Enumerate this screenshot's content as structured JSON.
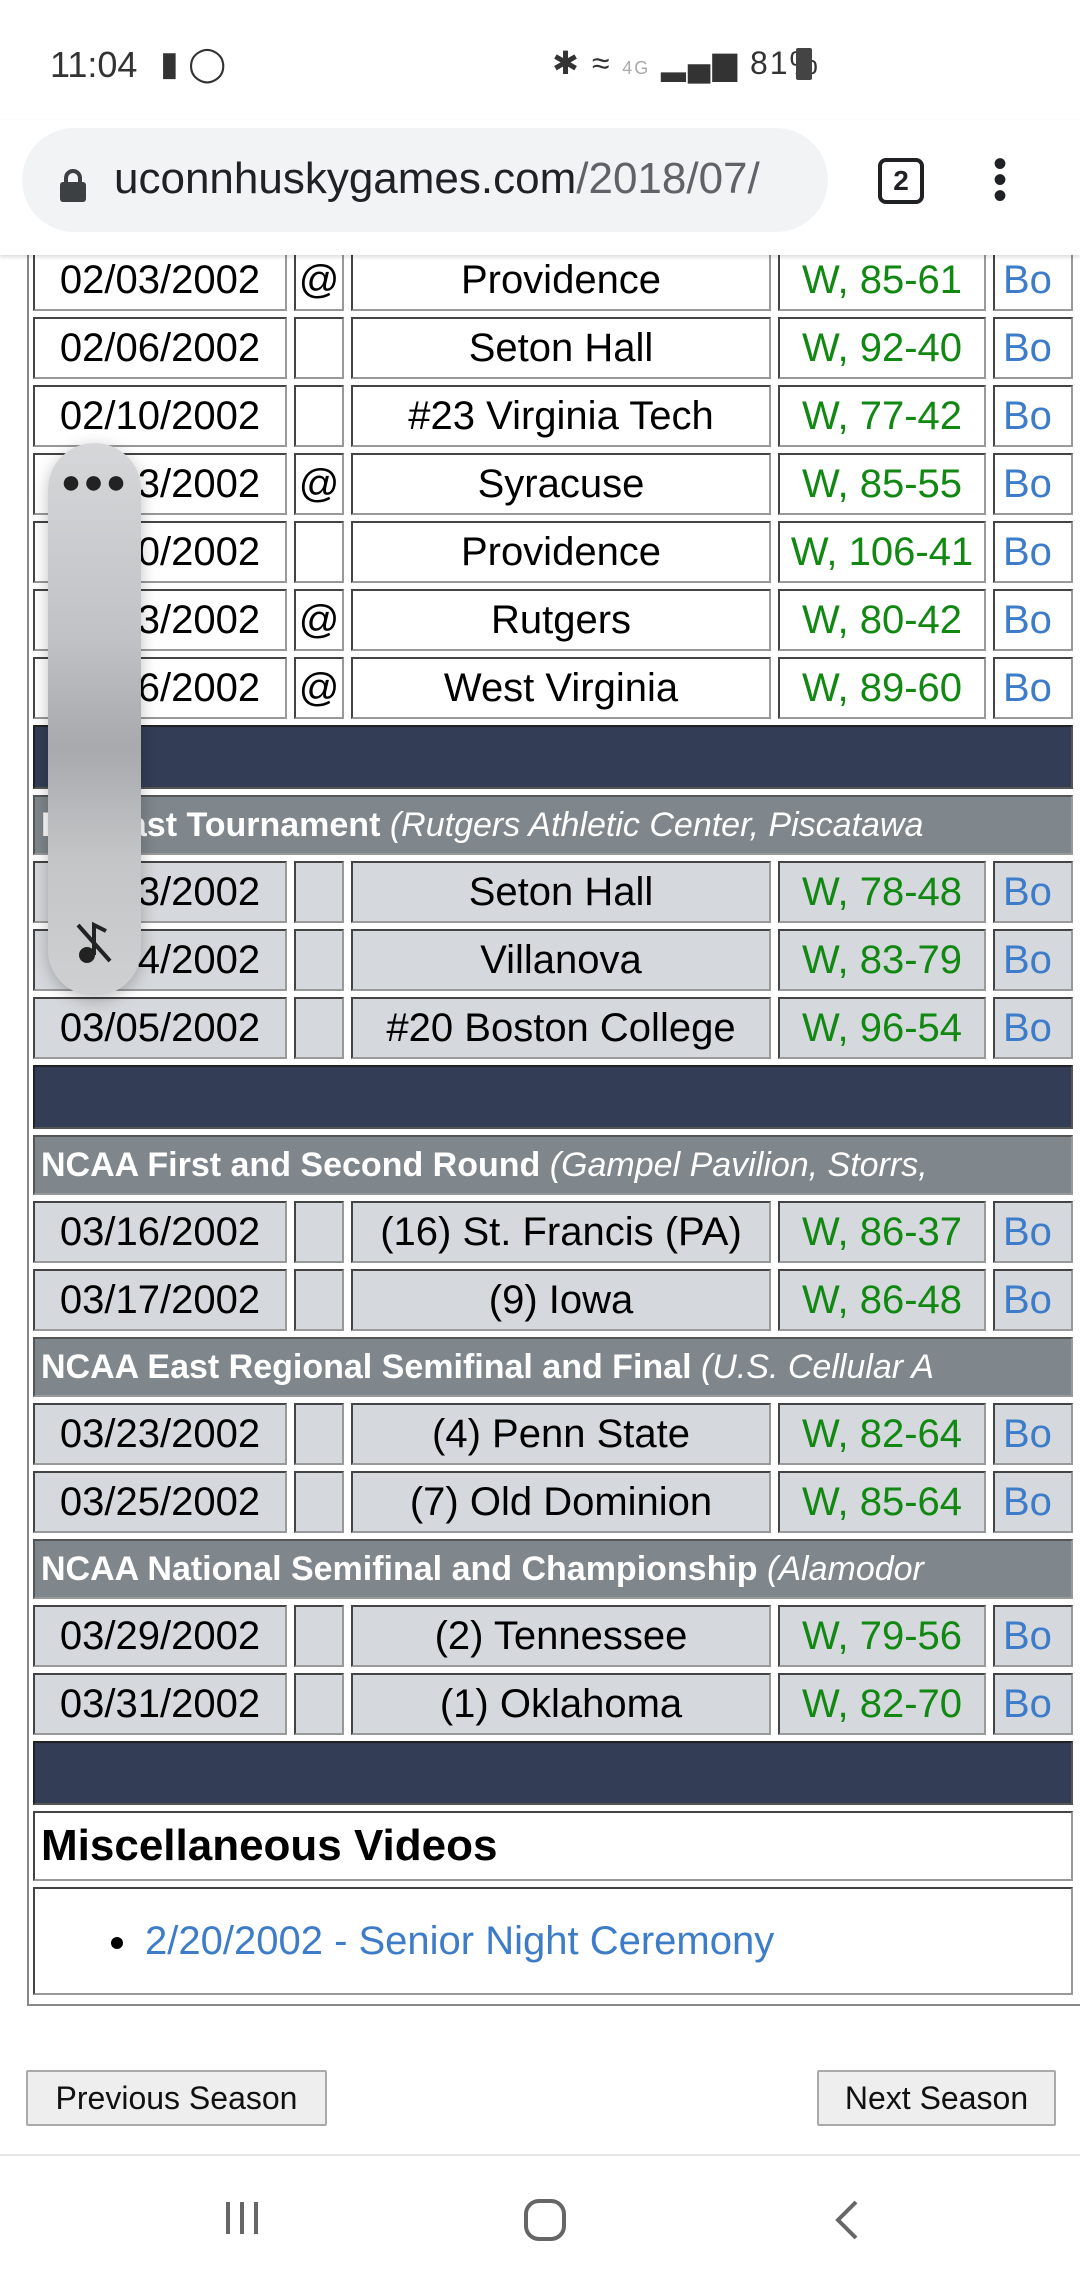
{
  "status_bar": {
    "time": "11:04",
    "network": "4G",
    "battery": "81%"
  },
  "browser": {
    "url_host": "uconnhuskygames.com",
    "url_path": "/2018/07/",
    "tab_count": "2"
  },
  "schedule": {
    "regular_rows": [
      {
        "date": "02/03/2002",
        "site": "@",
        "opponent": "Providence",
        "result": "W, 85-61",
        "link": "Bo"
      },
      {
        "date": "02/06/2002",
        "site": "",
        "opponent": "Seton Hall",
        "result": "W, 92-40",
        "link": "Bo"
      },
      {
        "date": "02/10/2002",
        "site": "",
        "opponent": "#23 Virginia Tech",
        "result": "W, 77-42",
        "link": "Bo"
      },
      {
        "date": "02/13/2002",
        "site": "@",
        "opponent": "Syracuse",
        "result": "W, 85-55",
        "link": "Bo"
      },
      {
        "date": "02/20/2002",
        "site": "",
        "opponent": "Providence",
        "result": "W, 106-41",
        "link": "Bo"
      },
      {
        "date": "02/23/2002",
        "site": "@",
        "opponent": "Rutgers",
        "result": "W, 80-42",
        "link": "Bo"
      },
      {
        "date": "02/26/2002",
        "site": "@",
        "opponent": "West Virginia",
        "result": "W, 89-60",
        "link": "Bo"
      }
    ],
    "sections": [
      {
        "title": "Big East Tournament",
        "venue": "(Rutgers Athletic Center, Piscatawa",
        "rows": [
          {
            "date": "03/03/2002",
            "site": "",
            "opponent": "Seton Hall",
            "result": "W, 78-48",
            "link": "Bo"
          },
          {
            "date": "03/04/2002",
            "site": "",
            "opponent": "Villanova",
            "result": "W, 83-79",
            "link": "Bo"
          },
          {
            "date": "03/05/2002",
            "site": "",
            "opponent": "#20 Boston College",
            "result": "W, 96-54",
            "link": "Bo"
          }
        ]
      },
      {
        "title": "NCAA First and Second Round",
        "venue": "(Gampel Pavilion, Storrs,",
        "rows": [
          {
            "date": "03/16/2002",
            "site": "",
            "opponent": "(16) St. Francis (PA)",
            "result": "W, 86-37",
            "link": "Bo"
          },
          {
            "date": "03/17/2002",
            "site": "",
            "opponent": "(9) Iowa",
            "result": "W, 86-48",
            "link": "Bo"
          }
        ]
      },
      {
        "title": "NCAA East Regional Semifinal and Final",
        "venue": "(U.S. Cellular A",
        "rows": [
          {
            "date": "03/23/2002",
            "site": "",
            "opponent": "(4) Penn State",
            "result": "W, 82-64",
            "link": "Bo"
          },
          {
            "date": "03/25/2002",
            "site": "",
            "opponent": "(7) Old Dominion",
            "result": "W, 85-64",
            "link": "Bo"
          }
        ]
      },
      {
        "title": "NCAA National Semifinal and Championship",
        "venue": "(Alamodor",
        "rows": [
          {
            "date": "03/29/2002",
            "site": "",
            "opponent": "(2) Tennessee",
            "result": "W, 79-56",
            "link": "Bo"
          },
          {
            "date": "03/31/2002",
            "site": "",
            "opponent": "(1) Oklahoma",
            "result": "W, 82-70",
            "link": "Bo"
          }
        ]
      }
    ]
  },
  "misc": {
    "title": "Miscellaneous Videos",
    "links": [
      "2/20/2002 - Senior Night Ceremony"
    ]
  },
  "pager": {
    "prev": "Previous Season",
    "next": "Next Season"
  },
  "colors": {
    "win": "#118811",
    "link": "#3d7cc9",
    "band": "#333d55",
    "header": "#7f878c"
  }
}
